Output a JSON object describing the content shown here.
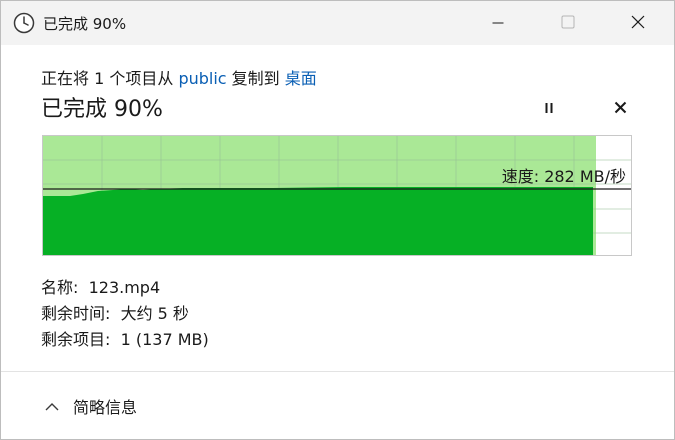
{
  "window": {
    "title": "已完成 90%",
    "icons": {
      "app": "clock-icon",
      "minimize": "minimize-icon",
      "maximize": "maximize-icon",
      "close": "close-icon"
    }
  },
  "copy": {
    "prefix": "正在将 1 个项目从 ",
    "source": "public",
    "middle": " 复制到 ",
    "destination": "桌面"
  },
  "status": {
    "title": "已完成 90%",
    "progress_percent": 90,
    "pause_icon": "pause-icon",
    "stop_icon": "stop-x-icon"
  },
  "graph": {
    "speed_text": "速度: 282 MB/秒",
    "colors": {
      "fill": "#06b025",
      "fill_light": "#aae896",
      "line": "#1a1a1a"
    }
  },
  "details": {
    "name_label": "名称:",
    "name_value": "123.mp4",
    "time_label": "剩余时间:",
    "time_value": "大约 5 秒",
    "items_label": "剩余项目:",
    "items_value": "1 (137 MB)"
  },
  "footer": {
    "collapse_label": "简略信息",
    "collapse_icon": "chevron-up-icon"
  },
  "colors": {
    "link": "#0a5fb4",
    "titlebar": "#f3f3f3"
  }
}
